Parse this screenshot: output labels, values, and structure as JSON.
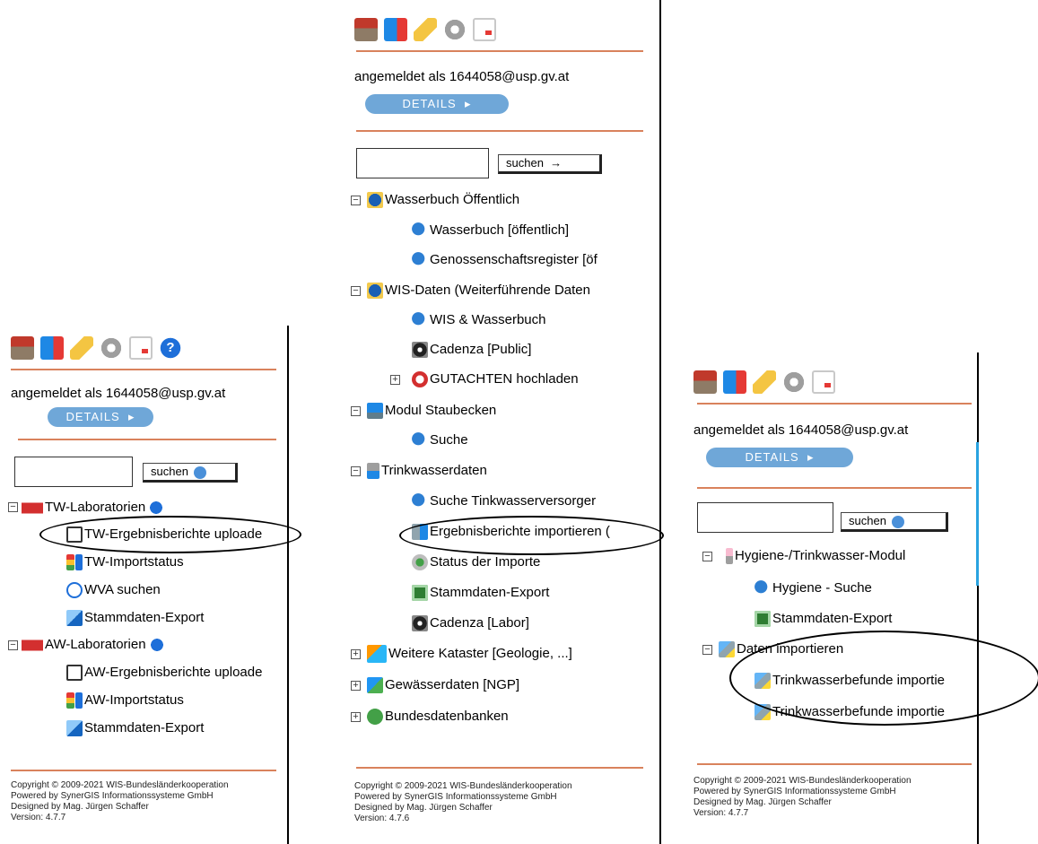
{
  "panels": [
    {
      "login_text": "angemeldet als 1644058@usp.gv.at",
      "details_label": "DETAILS",
      "search_label": "suchen",
      "tree": [
        {
          "label": "TW-Laboratorien",
          "level": 0
        },
        {
          "label": "TW-Ergebnisberichte uploade",
          "level": 1
        },
        {
          "label": "TW-Importstatus",
          "level": 1
        },
        {
          "label": "WVA suchen",
          "level": 1
        },
        {
          "label": "Stammdaten-Export",
          "level": 1
        },
        {
          "label": "AW-Laboratorien",
          "level": 0
        },
        {
          "label": "AW-Ergebnisberichte uploade",
          "level": 1
        },
        {
          "label": "AW-Importstatus",
          "level": 1
        },
        {
          "label": "Stammdaten-Export",
          "level": 1
        }
      ],
      "footer": [
        "Copyright © 2009-2021 WIS-Bundesländerkooperation",
        "Powered by SynerGIS Informationssysteme GmbH",
        "Designed by Mag. Jürgen Schaffer",
        "Version: 4.7.7"
      ]
    },
    {
      "login_text": "angemeldet als 1644058@usp.gv.at",
      "details_label": "DETAILS",
      "search_label": "suchen",
      "tree": [
        {
          "label": "Wasserbuch Öffentlich",
          "level": 0
        },
        {
          "label": "Wasserbuch [öffentlich]",
          "level": 1
        },
        {
          "label": "Genossenschaftsregister [öf",
          "level": 1
        },
        {
          "label": "WIS-Daten (Weiterführende Daten",
          "level": 0
        },
        {
          "label": "WIS & Wasserbuch",
          "level": 1
        },
        {
          "label": "Cadenza [Public]",
          "level": 1
        },
        {
          "label": "GUTACHTEN hochladen",
          "level": 1
        },
        {
          "label": "Modul Staubecken",
          "level": 0
        },
        {
          "label": "Suche",
          "level": 1
        },
        {
          "label": "Trinkwasserdaten",
          "level": 0
        },
        {
          "label": "Suche Tinkwasserversorger",
          "level": 1
        },
        {
          "label": "Ergebnisberichte importieren (",
          "level": 1
        },
        {
          "label": "Status der Importe",
          "level": 1
        },
        {
          "label": "Stammdaten-Export",
          "level": 1
        },
        {
          "label": "Cadenza [Labor]",
          "level": 1
        },
        {
          "label": "Weitere Kataster [Geologie, ...]",
          "level": 0
        },
        {
          "label": "Gewässerdaten [NGP]",
          "level": 0
        },
        {
          "label": "Bundesdatenbanken",
          "level": 0
        }
      ],
      "footer": [
        "Copyright © 2009-2021 WIS-Bundesländerkooperation",
        "Powered by SynerGIS Informationssysteme GmbH",
        "Designed by Mag. Jürgen Schaffer",
        "Version: 4.7.6"
      ]
    },
    {
      "login_text": "angemeldet als 1644058@usp.gv.at",
      "details_label": "DETAILS",
      "search_label": "suchen",
      "tree": [
        {
          "label": "Hygiene-/Trinkwasser-Modul",
          "level": 0
        },
        {
          "label": "Hygiene - Suche",
          "level": 1
        },
        {
          "label": "Stammdaten-Export",
          "level": 1
        },
        {
          "label": "Daten importieren",
          "level": 0
        },
        {
          "label": "Trinkwasserbefunde importie",
          "level": 1
        },
        {
          "label": "Trinkwasserbefunde importie",
          "level": 1
        }
      ],
      "footer": [
        "Copyright © 2009-2021 WIS-Bundesländerkooperation",
        "Powered by SynerGIS Informationssysteme GmbH",
        "Designed by Mag. Jürgen Schaffer",
        "Version: 4.7.7"
      ]
    }
  ],
  "help_icon_glyph": "?",
  "colors": {
    "separator": "#d9825c",
    "details_button": "#6fa7d8",
    "highlight_outline": "#000000"
  }
}
